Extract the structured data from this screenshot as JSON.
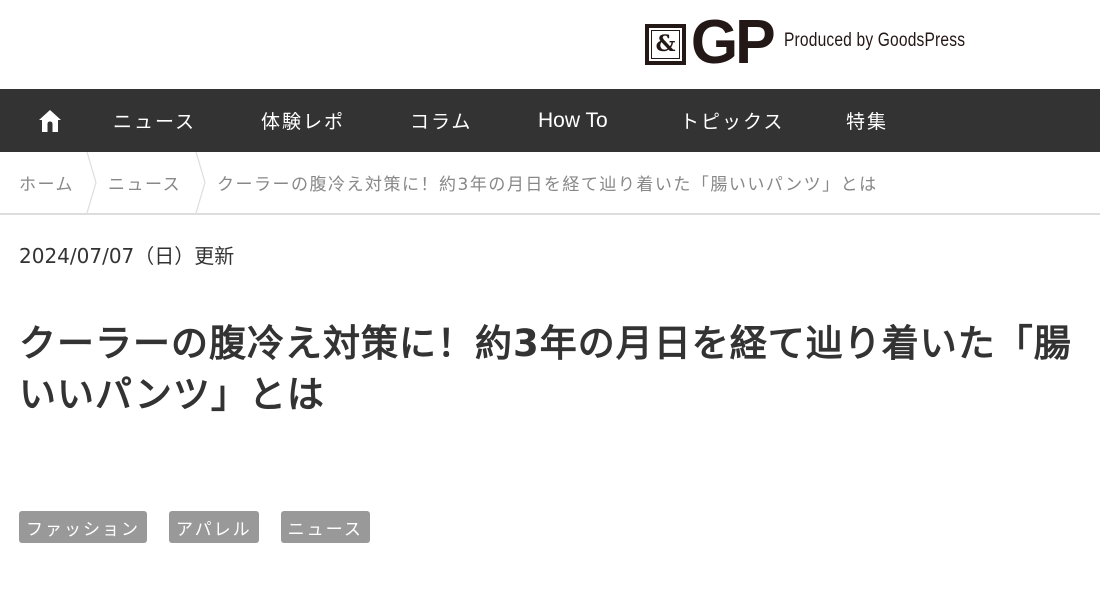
{
  "header": {
    "logo": {
      "mark": "&",
      "wordmark": "GP",
      "tagline": "Produced by GoodsPress"
    }
  },
  "nav": {
    "home_icon": "home-icon",
    "items": [
      {
        "label": "ニュース"
      },
      {
        "label": "体験レポ"
      },
      {
        "label": "コラム"
      },
      {
        "label": "How To"
      },
      {
        "label": "トピックス"
      },
      {
        "label": "特集"
      }
    ]
  },
  "breadcrumb": {
    "items": [
      {
        "label": "ホーム"
      },
      {
        "label": "ニュース"
      },
      {
        "label": "クーラーの腹冷え対策に！約3年の月日を経て辿り着いた「腸いいパンツ」とは"
      }
    ]
  },
  "article": {
    "date": "2024/07/07（日）更新",
    "title": "クーラーの腹冷え対策に！約3年の月日を経て辿り着いた「腸いいパンツ」とは",
    "tags": [
      {
        "label": "ファッション"
      },
      {
        "label": "アパレル"
      },
      {
        "label": "ニュース"
      }
    ]
  },
  "colors": {
    "navbar_bg": "#333333",
    "tag_bg": "#999999",
    "breadcrumb_text": "#888888",
    "logo": "#231815"
  }
}
